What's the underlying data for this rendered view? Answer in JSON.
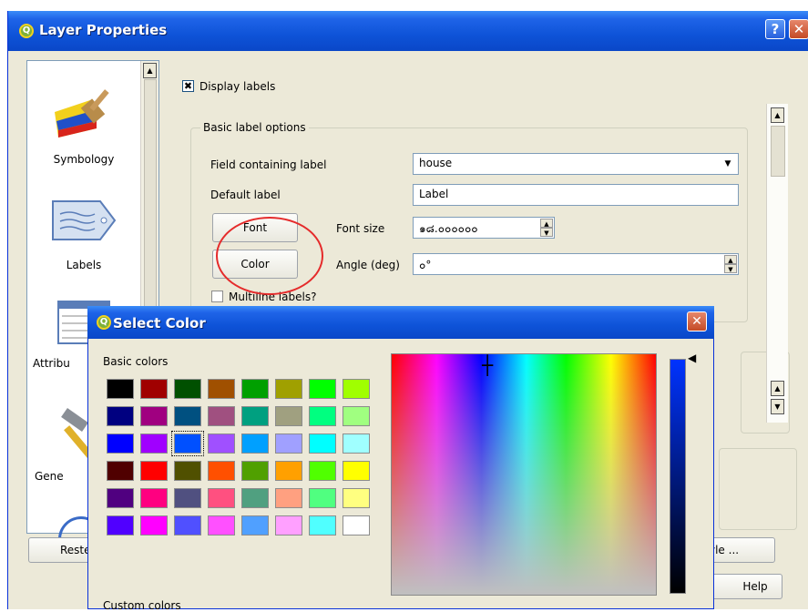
{
  "window": {
    "title": "Layer Properties",
    "help_glyph": "?",
    "close_glyph": "✕"
  },
  "sidebar": {
    "items": [
      {
        "label": "Symbology",
        "icon": "paintbrush-icon"
      },
      {
        "label": "Labels",
        "icon": "label-tag-icon"
      },
      {
        "label": "Attribu",
        "icon": "attribute-table-icon"
      },
      {
        "label": "Gene",
        "icon": "hammer-icon"
      }
    ]
  },
  "labels_panel": {
    "display_labels": {
      "label": "Display labels",
      "checked_glyph": "✖"
    },
    "group_title": "Basic label options",
    "field_label": "Field containing label",
    "field_value": "house",
    "default_label_label": "Default label",
    "default_label_value": "Label",
    "font_button": "Font",
    "font_size_label": "Font size",
    "font_size_value": "๑๘.๐๐๐๐๐๐",
    "color_button": "Color",
    "angle_label": "Angle (deg)",
    "angle_value": "๐°",
    "multiline_label": "Multiline labels?"
  },
  "bottom_buttons": {
    "restore": "Reste",
    "style": "yle ...",
    "help": "Help"
  },
  "color_dialog": {
    "title": "Select Color",
    "close_glyph": "✕",
    "basic_colors_label": "Basic colors",
    "custom_colors_label": "Custom colors",
    "crosshair_glyph": "┼",
    "luminance_arrow": "◀",
    "colors": [
      [
        "#000000",
        "#a00000",
        "#005000",
        "#a05000",
        "#00a000",
        "#a0a000",
        "#00ff00",
        "#a0ff00"
      ],
      [
        "#000080",
        "#a00080",
        "#005080",
        "#a05080",
        "#00a080",
        "#a0a080",
        "#00ff80",
        "#a0ff80"
      ],
      [
        "#0000ff",
        "#a000ff",
        "#0050ff",
        "#a050ff",
        "#00a0ff",
        "#a0a0ff",
        "#00ffff",
        "#a0ffff"
      ],
      [
        "#500000",
        "#ff0000",
        "#505000",
        "#ff5000",
        "#50a000",
        "#ffa000",
        "#50ff00",
        "#ffff00"
      ],
      [
        "#500080",
        "#ff0080",
        "#505080",
        "#ff5080",
        "#50a080",
        "#ffa080",
        "#50ff80",
        "#ffff80"
      ],
      [
        "#5000ff",
        "#ff00ff",
        "#5050ff",
        "#ff50ff",
        "#50a0ff",
        "#ffa0ff",
        "#50ffff",
        "#ffffff"
      ]
    ],
    "selected": {
      "row": 2,
      "col": 2
    }
  },
  "scroll_glyphs": {
    "up": "▲",
    "down": "▼"
  }
}
